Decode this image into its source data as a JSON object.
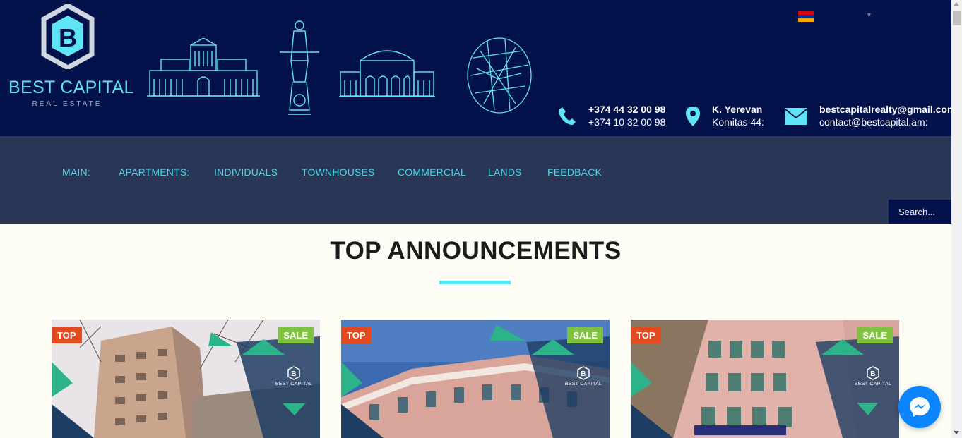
{
  "brand": {
    "name": "BEST CAPITAL",
    "tagline": "REAL ESTATE",
    "accent_color": "#5fe4f4",
    "header_bg": "#03124a",
    "nav_bg": "#293655"
  },
  "language": {
    "selected": "Armenian flag",
    "icon": "chevron-down-icon"
  },
  "contacts": {
    "phone": {
      "icon": "phone-icon",
      "line1": "+374 44 32 00 98",
      "line2": "+374 10 32 00 98"
    },
    "address": {
      "icon": "map-pin-icon",
      "line1": "K. Yerevan",
      "line2": "Komitas 44:"
    },
    "email": {
      "icon": "envelope-icon",
      "line1": "bestcapitalrealty@gmail.com",
      "line2": "contact@bestcapital.am:"
    }
  },
  "nav": {
    "items": [
      {
        "label": "MAIN:"
      },
      {
        "label": "APARTMENTS:"
      },
      {
        "label": "INDIVIDUALS"
      },
      {
        "label": "TOWNHOUSES"
      },
      {
        "label": "COMMERCIAL"
      },
      {
        "label": "LANDS"
      },
      {
        "label": "FEEDBACK"
      }
    ],
    "search_placeholder": "Search..."
  },
  "section": {
    "title": "TOP ANNOUNCEMENTS"
  },
  "cards": [
    {
      "badge_left": "TOP",
      "badge_right": "SALE",
      "watermark": "BEST CAPITAL"
    },
    {
      "badge_left": "TOP",
      "badge_right": "SALE",
      "watermark": "BEST CAPITAL"
    },
    {
      "badge_left": "TOP",
      "badge_right": "SALE",
      "watermark": "BEST CAPITAL"
    }
  ],
  "chat": {
    "icon": "messenger-icon"
  }
}
